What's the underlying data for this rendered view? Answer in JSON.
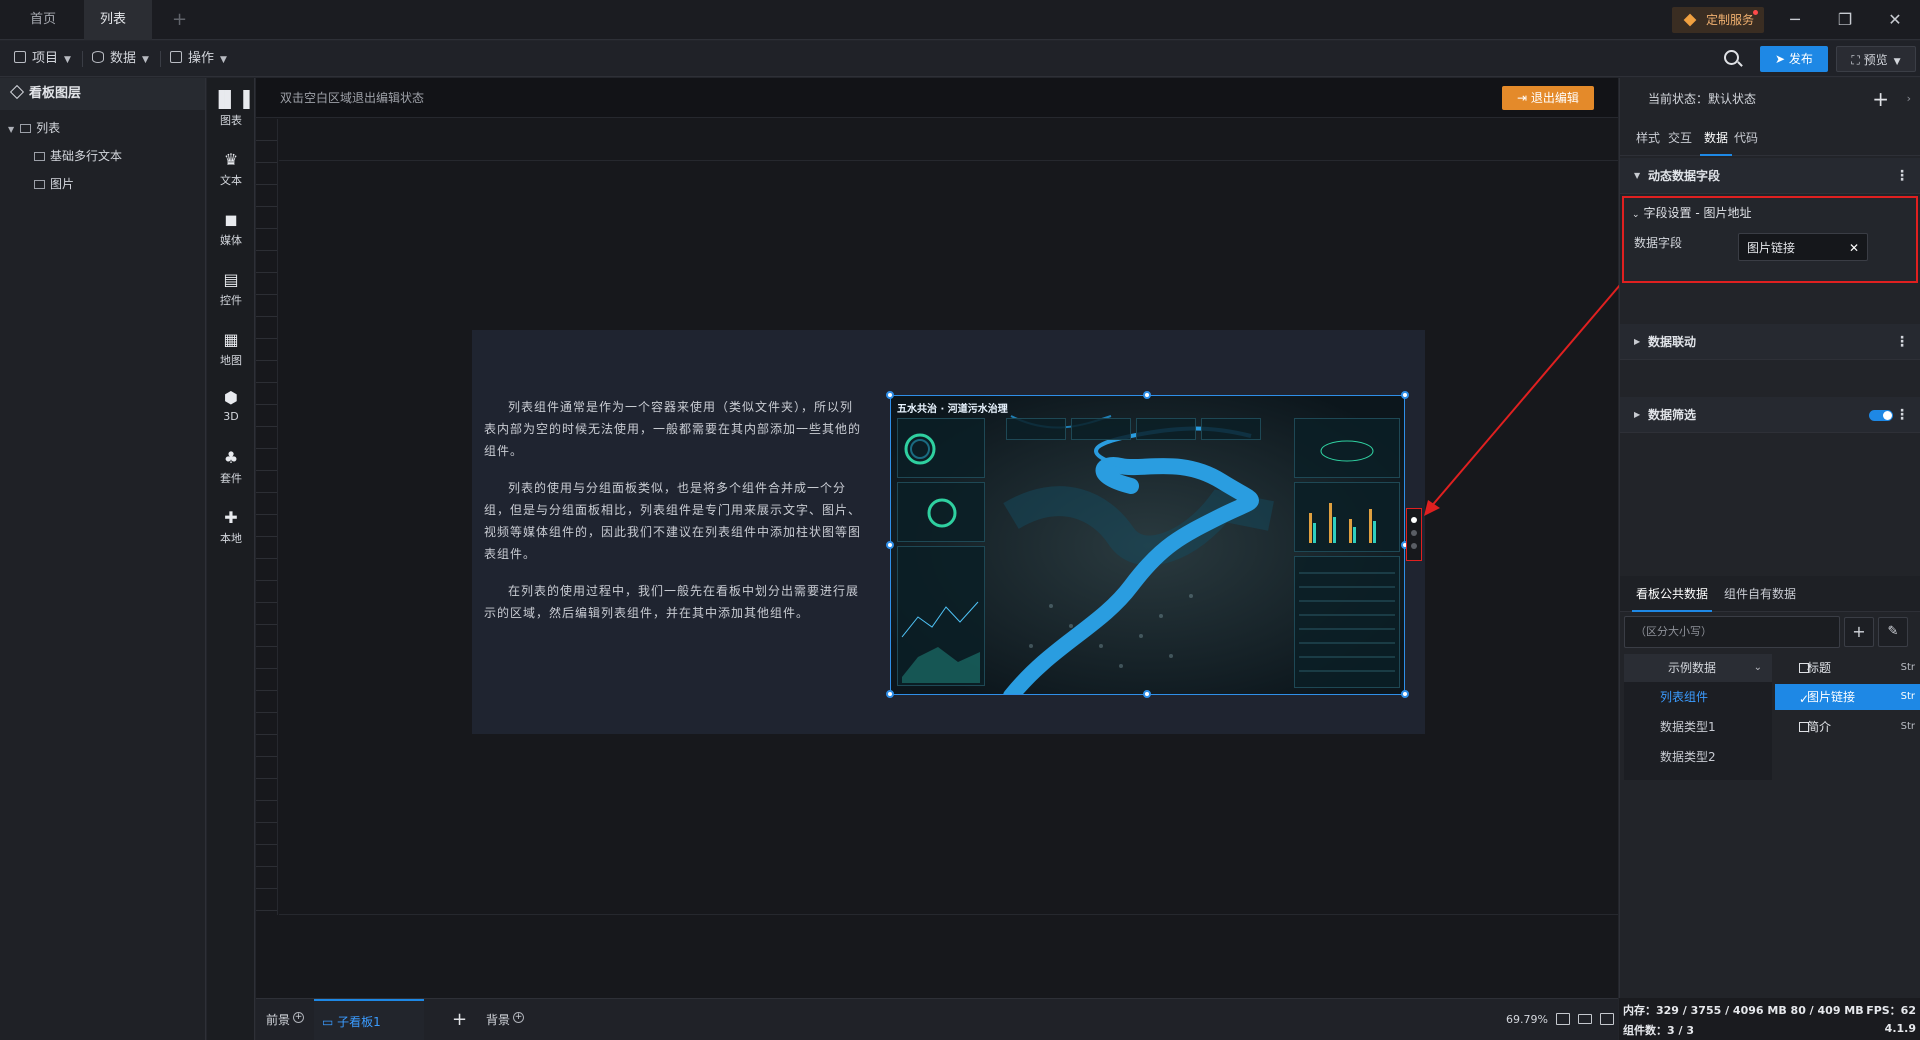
{
  "tabs": [
    {
      "label": "首页"
    },
    {
      "label": "列表"
    }
  ],
  "titlebar": {
    "custom_service": "定制服务",
    "add_tab": "+",
    "minimize": "─",
    "maximize": "❐",
    "close": "✕"
  },
  "menubar": {
    "project": "项目",
    "data": "数据",
    "operation": "操作",
    "publish": "发布",
    "preview": "预览"
  },
  "layers": {
    "header": "看板图层",
    "items": [
      {
        "label": "列表"
      },
      {
        "label": "基础多行文本"
      },
      {
        "label": "图片"
      }
    ]
  },
  "components": [
    {
      "label": "图表",
      "icon": "bar-chart-icon"
    },
    {
      "label": "文本",
      "icon": "text-icon"
    },
    {
      "label": "媒体",
      "icon": "media-icon"
    },
    {
      "label": "控件",
      "icon": "widget-icon"
    },
    {
      "label": "地图",
      "icon": "map-icon"
    },
    {
      "label": "3D",
      "icon": "cube-icon"
    },
    {
      "label": "套件",
      "icon": "kit-icon"
    },
    {
      "label": "本地",
      "icon": "puzzle-icon"
    }
  ],
  "canvas": {
    "hint": "双击空白区域退出编辑状态",
    "exit_edit": "退出编辑",
    "paragraphs": [
      "列表组件通常是作为一个容器来使用（类似文件夹），所以列表内部为空的时候无法使用，一般都需要在其内部添加一些其他的组件。",
      "列表的使用与分组面板类似，也是将多个组件合并成一个分组，但是与分组面板相比，列表组件是专门用来展示文字、图片、视频等媒体组件的，因此我们不建议在列表组件中添加柱状图等图表组件。",
      "在列表的使用过程中，我们一般先在看板中划分出需要进行展示的区域，然后编辑列表组件，并在其中添加其他组件。"
    ],
    "dashboard_title": "五水共治 · 河道污水治理"
  },
  "bottom_tabs": {
    "foreground": "前景",
    "sub_board": "子看板1",
    "background": "背景",
    "zoom": "69.79%"
  },
  "right_panel": {
    "state_label": "当前状态：默认状态",
    "tabs": [
      {
        "label": "样式"
      },
      {
        "label": "交互"
      },
      {
        "label": "数据"
      },
      {
        "label": "代码"
      }
    ],
    "dynamic_fields": "动态数据字段",
    "field_settings": "字段设置 - 图片地址",
    "data_field_label": "数据字段",
    "data_field_value": "图片链接",
    "data_linkage": "数据联动",
    "data_filter": "数据筛选",
    "data_tabs": [
      {
        "label": "看板公共数据"
      },
      {
        "label": "组件自有数据"
      }
    ],
    "search_placeholder": "（区分大小写）",
    "source_select": "示例数据",
    "sources": [
      {
        "label": "列表组件"
      },
      {
        "label": "数据类型1"
      },
      {
        "label": "数据类型2"
      }
    ],
    "fields": [
      {
        "label": "标题",
        "type": "Str"
      },
      {
        "label": "图片链接",
        "type": "Str"
      },
      {
        "label": "简介",
        "type": "Str"
      }
    ]
  },
  "status": {
    "memory": "内存：329 / 3755 / 4096 MB  80 / 409 MB",
    "fps": "FPS：62",
    "component_count": "组件数：3 / 3",
    "version": "4.1.9"
  },
  "colors": {
    "accent": "#1e88e5",
    "annotation_red": "#e02020",
    "exit_orange": "#e48a2a"
  }
}
